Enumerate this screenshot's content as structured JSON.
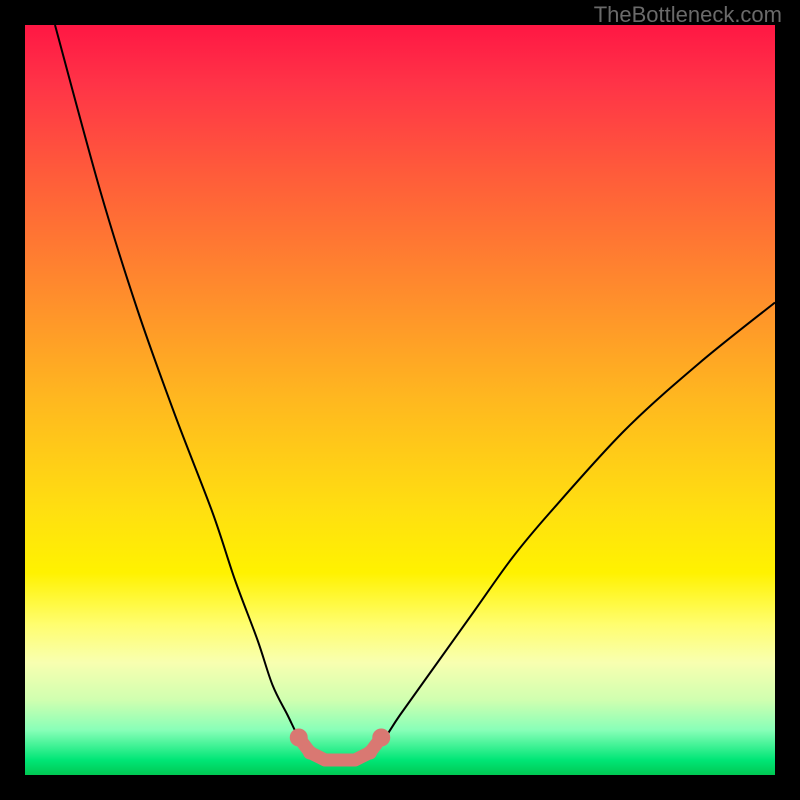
{
  "watermark": "TheBottleneck.com",
  "chart_data": {
    "type": "line",
    "title": "",
    "xlabel": "",
    "ylabel": "",
    "xlim": [
      0,
      100
    ],
    "ylim": [
      0,
      100
    ],
    "series": [
      {
        "name": "bottleneck-curve",
        "x": [
          4,
          10,
          15,
          20,
          25,
          28,
          31,
          33,
          35,
          36.5,
          38,
          40,
          42,
          44,
          46,
          48,
          50,
          55,
          60,
          65,
          70,
          80,
          90,
          100
        ],
        "y": [
          100,
          78,
          62,
          48,
          35,
          26,
          18,
          12,
          8,
          5,
          3,
          2,
          2,
          2,
          3,
          5,
          8,
          15,
          22,
          29,
          35,
          46,
          55,
          63
        ]
      }
    ],
    "highlight_points": {
      "name": "optimal-zone",
      "color": "#d97872",
      "x": [
        36.5,
        38,
        40,
        42,
        44,
        46,
        47.5
      ],
      "y": [
        5,
        3,
        2,
        2,
        2,
        3,
        5
      ]
    },
    "gradient_stops": [
      {
        "pos": 0.0,
        "color": "#ff1744"
      },
      {
        "pos": 0.5,
        "color": "#ffe010"
      },
      {
        "pos": 0.8,
        "color": "#fffe70"
      },
      {
        "pos": 1.0,
        "color": "#00c853"
      }
    ]
  }
}
